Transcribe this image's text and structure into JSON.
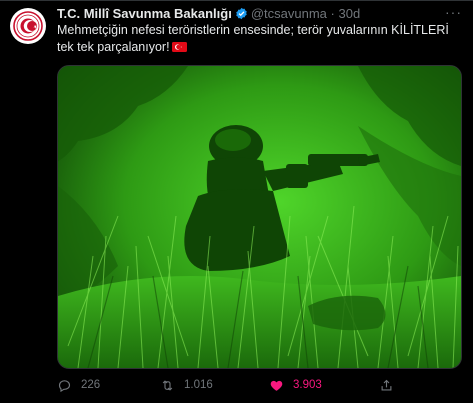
{
  "author": {
    "name": "T.C. Millî Savunma Bakanlığı",
    "handle": "@tcsavunma",
    "separator": "·",
    "time": "30d"
  },
  "tweet": {
    "text": "Mehmetçiğin nefesi teröristlerin ensesinde; terör yuvalarının KİLİTLERİ tek tek parçalanıyor!"
  },
  "icons": {
    "verified": "verified-badge-icon",
    "more": "more-icon",
    "flag": "turkey-flag-icon",
    "reply": "reply-icon",
    "retweet": "retweet-icon",
    "like": "heart-icon",
    "share": "share-icon"
  },
  "more_glyph": "···",
  "stats": {
    "replies": "226",
    "retweets": "1.016",
    "likes": "3.903"
  },
  "colors": {
    "background": "#000000",
    "text": "#e7e9ea",
    "muted": "#71767b",
    "verified": "#1d9bf0",
    "like": "#f91880",
    "night_vision_green": "#39b51a"
  }
}
